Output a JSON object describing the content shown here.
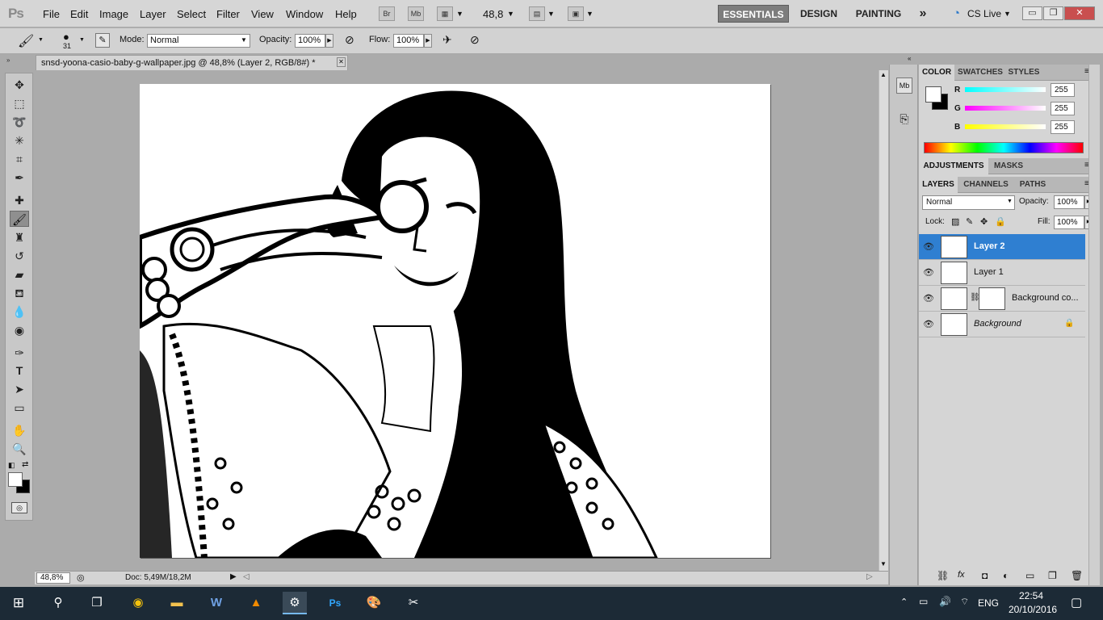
{
  "app": {
    "logo": "Ps"
  },
  "menu": [
    "File",
    "Edit",
    "Image",
    "Layer",
    "Select",
    "Filter",
    "View",
    "Window",
    "Help"
  ],
  "menubar_buttons": {
    "bridge": "Br",
    "mini_bridge": "Mb",
    "zoom": "48,8"
  },
  "workspaces": [
    "ESSENTIALS",
    "DESIGN",
    "PAINTING"
  ],
  "workspaces_more": "»",
  "cslive": "CS Live",
  "window_controls": {
    "minimize": "▭",
    "restore": "❐",
    "close": "✕"
  },
  "options": {
    "brush_size": "31",
    "mode_label": "Mode:",
    "mode_value": "Normal",
    "opacity_label": "Opacity:",
    "opacity_value": "100%",
    "flow_label": "Flow:",
    "flow_value": "100%"
  },
  "document": {
    "tab_title": "snsd-yoona-casio-baby-g-wallpaper.jpg @ 48,8% (Layer 2, RGB/8#) *",
    "close": "✕"
  },
  "status": {
    "zoom": "48,8%",
    "doc": "Doc: 5,49M/18,2M"
  },
  "color_panel": {
    "tabs": [
      "COLOR",
      "SWATCHES",
      "STYLES"
    ],
    "r_label": "R",
    "g_label": "G",
    "b_label": "B",
    "r": "255",
    "g": "255",
    "b": "255"
  },
  "adjust_panel": {
    "tabs": [
      "ADJUSTMENTS",
      "MASKS"
    ]
  },
  "layers_panel": {
    "tabs": [
      "LAYERS",
      "CHANNELS",
      "PATHS"
    ],
    "blend_mode": "Normal",
    "opacity_label": "Opacity:",
    "opacity": "100%",
    "lock_label": "Lock:",
    "fill_label": "Fill:",
    "fill": "100%",
    "layers": [
      {
        "name": "Layer 2",
        "selected": true
      },
      {
        "name": "Layer 1",
        "selected": false
      },
      {
        "name": "Background co...",
        "selected": false
      },
      {
        "name": "Background",
        "selected": false
      }
    ]
  },
  "taskbar": {
    "lang": "ENG",
    "time": "22:54",
    "date": "20/10/2016"
  },
  "colors": {
    "selection": "#2f7fd1",
    "menubar": "#d6d6d6",
    "taskbar": "#1c2a36"
  }
}
